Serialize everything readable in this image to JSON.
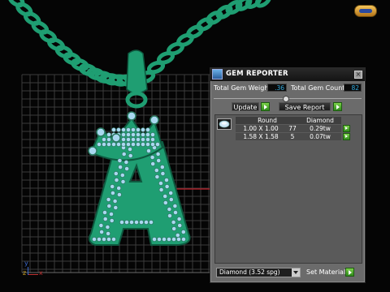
{
  "panel": {
    "title": "GEM REPORTER",
    "total_weight_label": "Total Gem Weight",
    "total_weight_value": ".36",
    "total_count_label": "Total Gem Count",
    "total_count_value": "82",
    "update_label": "Update",
    "save_report_label": "Save Report",
    "table": {
      "headers": [
        "Round",
        "Diamond"
      ],
      "rows": [
        {
          "size": "1.00 X 1.00",
          "count": "77",
          "weight": "0.29tw"
        },
        {
          "size": "1.58 X 1.58",
          "count": "5",
          "weight": "0.07tw"
        }
      ]
    },
    "material_select_value": "Diamond   (3.52 spg)",
    "set_material_label": "Set Material"
  },
  "viewport": {
    "axis_y_label": "y",
    "axis_z_label": "z",
    "axis_x_label": "x"
  },
  "icons": {
    "badge": "logo-badge-icon",
    "gem": "round-gem-icon",
    "close": "close-icon",
    "dropdown": "chevron-down-icon"
  },
  "colors": {
    "metal": "#1f9e72",
    "gems": "#a9d8f0",
    "grid": "#3a3a3a",
    "x_axis": "#c0202a",
    "panel_bg": "#6b6b6b",
    "accent_go": "#4fb02a"
  }
}
